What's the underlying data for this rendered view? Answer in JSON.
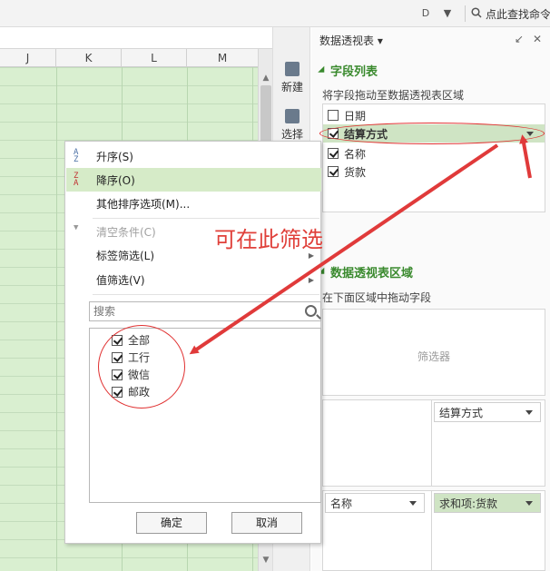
{
  "toolbar": {
    "search_command_label": "点此查找命令",
    "icons": [
      "d-icon",
      "dropdown-icon",
      "search-icon"
    ]
  },
  "sheet": {
    "columns": [
      "J",
      "K",
      "L",
      "M"
    ]
  },
  "side_tools": {
    "new_label": "新建",
    "select_label": "选择"
  },
  "pivot_panel": {
    "title": "数据透视表",
    "field_list": {
      "title": "字段列表",
      "hint": "将字段拖动至数据透视表区域",
      "fields": [
        {
          "label": "日期",
          "checked": false
        },
        {
          "label": "结算方式",
          "checked": true
        },
        {
          "label": "名称",
          "checked": true
        },
        {
          "label": "货款",
          "checked": true
        }
      ]
    },
    "areas": {
      "title": "数据透视表区域",
      "hint": "在下面区域中拖动字段",
      "filter_placeholder": "筛选器",
      "column_field": "结算方式",
      "row_field": "名称",
      "value_field": "求和项:货款"
    }
  },
  "popup": {
    "menu": {
      "sort_asc": "升序(S)",
      "sort_desc": "降序(O)",
      "more_sort": "其他排序选项(M)...",
      "clear": "清空条件(C)",
      "label_filter": "标签筛选(L)",
      "value_filter": "值筛选(V)"
    },
    "search_placeholder": "搜索",
    "items": [
      {
        "label": "全部",
        "checked": true
      },
      {
        "label": "工行",
        "checked": true
      },
      {
        "label": "微信",
        "checked": true
      },
      {
        "label": "邮政",
        "checked": true
      }
    ],
    "ok_label": "确定",
    "cancel_label": "取消"
  },
  "annotation_text": "可在此筛选",
  "colors": {
    "accent_green": "#3a8a2e",
    "highlight_green": "#cfe4c4",
    "sheet_green": "#d9efd0",
    "annotation_red": "#e03030"
  }
}
